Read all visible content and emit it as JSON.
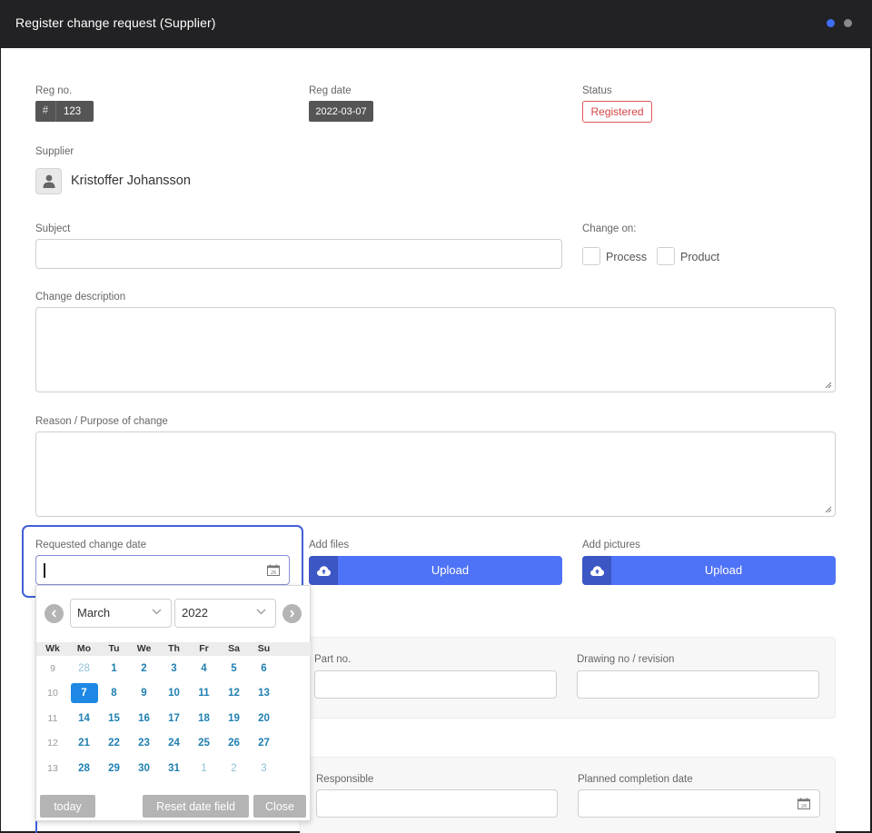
{
  "window": {
    "title": "Register change request (Supplier)",
    "indicator_colors": [
      "#3f6ef5",
      "#8a8a8a"
    ]
  },
  "reg_no": {
    "label": "Reg no.",
    "prefix": "#",
    "value": "123"
  },
  "reg_date": {
    "label": "Reg date",
    "value": "2022-03-07"
  },
  "status": {
    "label": "Status",
    "value": "Registered",
    "color": "#d64545"
  },
  "supplier": {
    "label": "Supplier",
    "name": "Kristoffer Johansson",
    "icon": "user-icon"
  },
  "subject": {
    "label": "Subject",
    "value": ""
  },
  "change_on": {
    "label": "Change on:",
    "options": [
      {
        "label": "Process",
        "checked": false
      },
      {
        "label": "Product",
        "checked": false
      }
    ]
  },
  "change_description": {
    "label": "Change description",
    "value": ""
  },
  "reason": {
    "label": "Reason / Purpose of change",
    "value": ""
  },
  "requested_change_date": {
    "label": "Requested change date",
    "value": "",
    "icon": "calendar-icon",
    "icon_text": "26"
  },
  "add_files": {
    "label": "Add files",
    "button": "Upload",
    "icon": "cloud-upload-icon"
  },
  "add_pictures": {
    "label": "Add pictures",
    "button": "Upload",
    "icon": "cloud-upload-icon"
  },
  "part_no": {
    "label": "Part no.",
    "value": ""
  },
  "drawing_no": {
    "label": "Drawing no / revision",
    "value": ""
  },
  "responsible": {
    "label": "Responsible",
    "value": ""
  },
  "planned_completion_date": {
    "label": "Planned completion date",
    "value": "",
    "icon": "calendar-icon",
    "icon_text": "26"
  },
  "datepicker": {
    "month": "March",
    "year": "2022",
    "headers": [
      "Wk",
      "Mo",
      "Tu",
      "We",
      "Th",
      "Fr",
      "Sa",
      "Su"
    ],
    "weeks": [
      {
        "wk": "9",
        "days": [
          {
            "d": "28",
            "other": true
          },
          {
            "d": "1"
          },
          {
            "d": "2"
          },
          {
            "d": "3"
          },
          {
            "d": "4"
          },
          {
            "d": "5"
          },
          {
            "d": "6"
          }
        ]
      },
      {
        "wk": "10",
        "days": [
          {
            "d": "7",
            "selected": true
          },
          {
            "d": "8"
          },
          {
            "d": "9"
          },
          {
            "d": "10"
          },
          {
            "d": "11"
          },
          {
            "d": "12"
          },
          {
            "d": "13"
          }
        ]
      },
      {
        "wk": "11",
        "days": [
          {
            "d": "14"
          },
          {
            "d": "15"
          },
          {
            "d": "16"
          },
          {
            "d": "17"
          },
          {
            "d": "18"
          },
          {
            "d": "19"
          },
          {
            "d": "20"
          }
        ]
      },
      {
        "wk": "12",
        "days": [
          {
            "d": "21"
          },
          {
            "d": "22"
          },
          {
            "d": "23"
          },
          {
            "d": "24"
          },
          {
            "d": "25"
          },
          {
            "d": "26"
          },
          {
            "d": "27"
          }
        ]
      },
      {
        "wk": "13",
        "days": [
          {
            "d": "28"
          },
          {
            "d": "29"
          },
          {
            "d": "30"
          },
          {
            "d": "31"
          },
          {
            "d": "1",
            "other": true
          },
          {
            "d": "2",
            "other": true
          },
          {
            "d": "3",
            "other": true
          }
        ]
      }
    ],
    "today_label": "today",
    "reset_label": "Reset date field",
    "close_label": "Close",
    "selected_color": "#1e88e5"
  }
}
